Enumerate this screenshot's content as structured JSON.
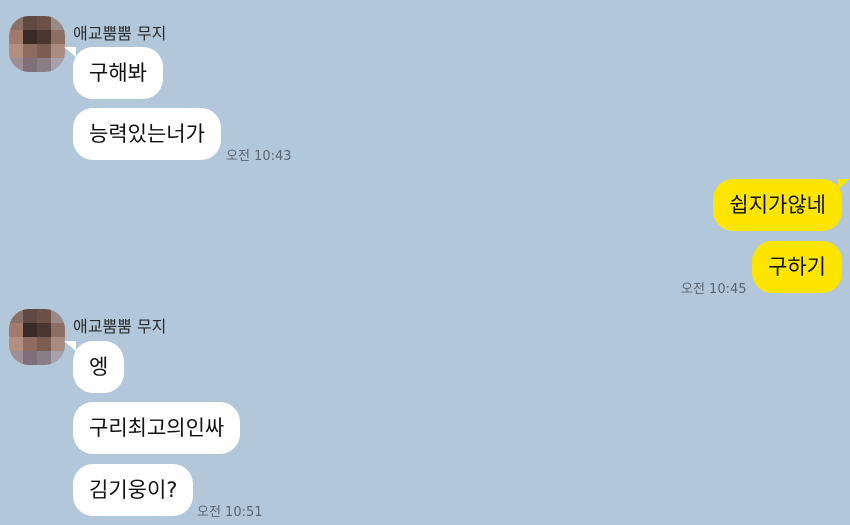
{
  "colors": {
    "background": "#b2c7da",
    "incoming_bubble": "#ffffff",
    "outgoing_bubble": "#fee500",
    "timestamp": "#5b6570"
  },
  "groups": [
    {
      "direction": "incoming",
      "sender": "애교뿜뿜 무지",
      "avatar": "pixelated-profile-photo",
      "messages": [
        "구해봐",
        "능력있는너가"
      ],
      "time": "오전 10:43"
    },
    {
      "direction": "outgoing",
      "messages": [
        "쉽지가않네",
        "구하기"
      ],
      "time": "오전 10:45"
    },
    {
      "direction": "incoming",
      "sender": "애교뿜뿜 무지",
      "avatar": "pixelated-profile-photo",
      "messages": [
        "엥",
        "구리최고의인싸",
        "김기웅이?"
      ],
      "time": "오전 10:51"
    }
  ]
}
